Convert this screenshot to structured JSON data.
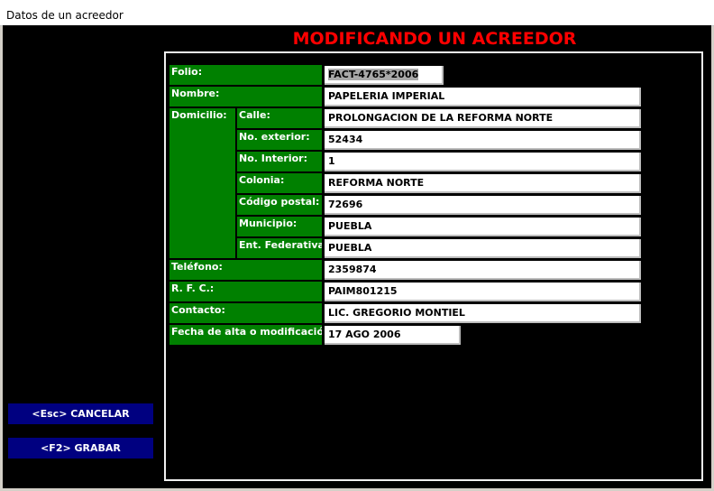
{
  "window": {
    "title": "Datos de un acreedor"
  },
  "form": {
    "heading": "MODIFICANDO UN ACREEDOR",
    "labels": {
      "folio": "Folio:",
      "nombre": "Nombre:",
      "domicilio": "Domicilio:",
      "calle": "Calle:",
      "no_exterior": "No. exterior:",
      "no_interior": "No. Interior:",
      "colonia": "Colonia:",
      "codigo_postal": "Código postal:",
      "municipio": "Municipio:",
      "ent_federativa": "Ent. Federativa:",
      "telefono": "Teléfono:",
      "rfc": "R. F. C.:",
      "contacto": "Contacto:",
      "fecha": "Fecha de alta o modificación:"
    },
    "values": {
      "folio": "FACT-4765*2006",
      "nombre": "PAPELERIA IMPERIAL",
      "calle": "PROLONGACION DE LA REFORMA NORTE",
      "no_exterior": "52434",
      "no_interior": "1",
      "colonia": "REFORMA NORTE",
      "codigo_postal": "72696",
      "municipio": "PUEBLA",
      "ent_federativa": "PUEBLA",
      "telefono": "2359874",
      "rfc": "PAIM801215",
      "contacto": "LIC. GREGORIO MONTIEL",
      "fecha": "17 AGO 2006"
    }
  },
  "buttons": {
    "cancel": "<Esc>   CANCELAR",
    "save": "<F2>   GRABAR"
  },
  "colors": {
    "label_bg": "#008000",
    "heading": "#ff0000",
    "button_bg": "#000080",
    "background": "#000000"
  }
}
